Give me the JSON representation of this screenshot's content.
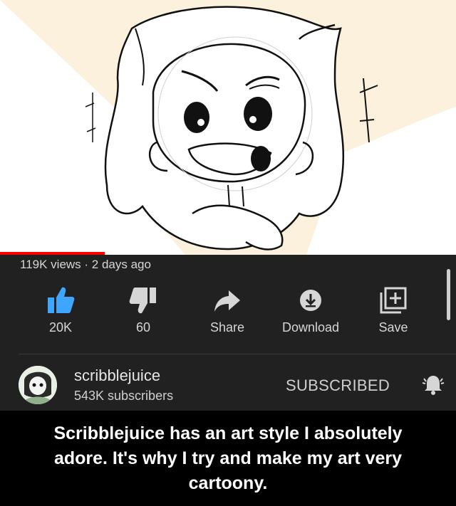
{
  "video": {
    "meta_line": "119K views · 2 days ago",
    "progress_fraction": 0.23
  },
  "actions": {
    "like_count": "20K",
    "dislike_count": "60",
    "share_label": "Share",
    "download_label": "Download",
    "save_label": "Save"
  },
  "channel": {
    "name": "scribblejuice",
    "subscribers": "543K subscribers",
    "subscribe_state": "SUBSCRIBED"
  },
  "caption": {
    "line1": "Scribblejuice has an art style I absolutely",
    "line2": "adore. It's why I try and make my art very",
    "line3": "cartoony."
  },
  "colors": {
    "like_blue": "#3ea6ff",
    "progress_red": "#ff0000",
    "panel_bg": "#212121",
    "caption_bg": "#000000"
  },
  "icons": [
    "thumbs-up-icon",
    "thumbs-down-icon",
    "share-arrow-icon",
    "download-icon",
    "save-playlist-icon",
    "bell-icon"
  ]
}
